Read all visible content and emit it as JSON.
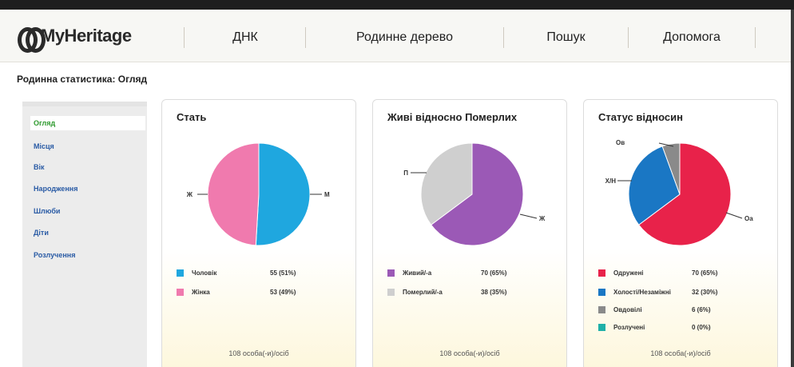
{
  "header": {
    "logo": "MyHeritage",
    "nav": [
      {
        "label": "ДНК"
      },
      {
        "label": "Родинне дерево"
      },
      {
        "label": "Пошук"
      },
      {
        "label": "Допомога"
      }
    ]
  },
  "page_title": "Родинна статистика: Огляд",
  "sidebar": {
    "items": [
      {
        "label": "Огляд",
        "active": true
      },
      {
        "label": "Місця"
      },
      {
        "label": "Вік"
      },
      {
        "label": "Народження"
      },
      {
        "label": "Шлюби"
      },
      {
        "label": "Діти"
      },
      {
        "label": "Розлучення"
      }
    ]
  },
  "cards": [
    {
      "title": "Стать",
      "footer": "108 особа(-и)/осіб",
      "legend": [
        {
          "label": "Чоловік",
          "value": "55 (51%)",
          "color": "#1fa7df"
        },
        {
          "label": "Жінка",
          "value": "53 (49%)",
          "color": "#f07aae"
        }
      ]
    },
    {
      "title": "Живі відносно Померлих",
      "footer": "108 особа(-и)/осіб",
      "legend": [
        {
          "label": "Живий/-а",
          "value": "70 (65%)",
          "color": "#9b59b6"
        },
        {
          "label": "Померлий/-а",
          "value": "38 (35%)",
          "color": "#cfcfcf"
        }
      ]
    },
    {
      "title": "Статус відносин",
      "footer": "108 особа(-и)/осіб",
      "legend": [
        {
          "label": "Одружені",
          "value": "70 (65%)",
          "color": "#e8224a"
        },
        {
          "label": "Холості/Незаміжні",
          "value": "32 (30%)",
          "color": "#1a77c4"
        },
        {
          "label": "Овдовілі",
          "value": "6 (6%)",
          "color": "#8a8a8a"
        },
        {
          "label": "Розлучені",
          "value": "0 (0%)",
          "color": "#1fb0a8"
        }
      ]
    }
  ],
  "chart_data": [
    {
      "type": "pie",
      "title": "Стать",
      "categories": [
        "Чоловік",
        "Жінка"
      ],
      "values": [
        55,
        53
      ],
      "slice_labels": [
        "М",
        "Ж"
      ],
      "colors": [
        "#1fa7df",
        "#f07aae"
      ]
    },
    {
      "type": "pie",
      "title": "Живі відносно Померлих",
      "categories": [
        "Живий/-а",
        "Померлий/-а"
      ],
      "values": [
        70,
        38
      ],
      "slice_labels": [
        "Ж",
        "П"
      ],
      "colors": [
        "#9b59b6",
        "#cfcfcf"
      ]
    },
    {
      "type": "pie",
      "title": "Статус відносин",
      "categories": [
        "Одружені",
        "Холості/Незаміжні",
        "Овдовілі",
        "Розлучені"
      ],
      "values": [
        70,
        32,
        6,
        0
      ],
      "slice_labels": [
        "Оа",
        "Х/Н",
        "Ов",
        ""
      ],
      "colors": [
        "#e8224a",
        "#1a77c4",
        "#8a8a8a",
        "#1fb0a8"
      ]
    }
  ]
}
